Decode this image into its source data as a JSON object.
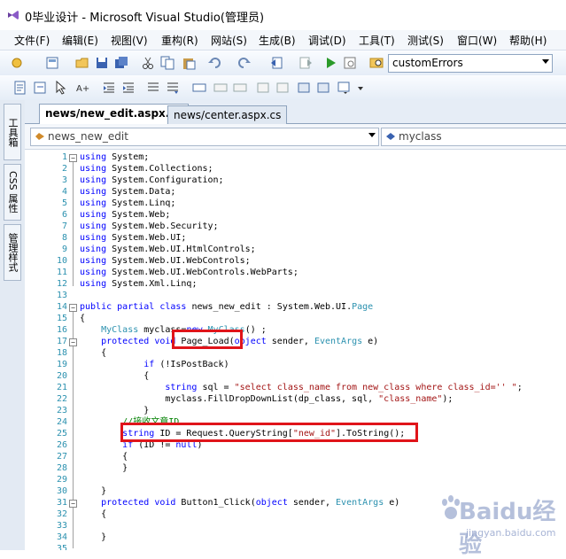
{
  "window": {
    "title": "0毕业设计 - Microsoft Visual Studio(管理员)"
  },
  "menu": [
    "文件(F)",
    "编辑(E)",
    "视图(V)",
    "重构(R)",
    "网站(S)",
    "生成(B)",
    "调试(D)",
    "工具(T)",
    "测试(S)",
    "窗口(W)",
    "帮助(H)"
  ],
  "toolbar": {
    "config_value": "customErrors"
  },
  "left_panel": {
    "toolbox_label": "工具箱",
    "css_label": "CSS 属性",
    "styles_label": "管理样式"
  },
  "tabs": [
    {
      "label": "news/new_edit.aspx.cs"
    },
    {
      "label": "news/center.aspx.cs"
    }
  ],
  "nav": {
    "class_combo": "news_new_edit",
    "member_combo": "myclass"
  },
  "code_lines": [
    {
      "n": "1",
      "t": "using System;"
    },
    {
      "n": "2",
      "t": "using System.Collections;"
    },
    {
      "n": "3",
      "t": "using System.Configuration;"
    },
    {
      "n": "4",
      "t": "using System.Data;"
    },
    {
      "n": "5",
      "t": "using System.Linq;"
    },
    {
      "n": "6",
      "t": "using System.Web;"
    },
    {
      "n": "7",
      "t": "using System.Web.Security;"
    },
    {
      "n": "8",
      "t": "using System.Web.UI;"
    },
    {
      "n": "9",
      "t": "using System.Web.UI.HtmlControls;"
    },
    {
      "n": "10",
      "t": "using System.Web.UI.WebControls;"
    },
    {
      "n": "11",
      "t": "using System.Web.UI.WebControls.WebParts;"
    },
    {
      "n": "12",
      "t": "using System.Xml.Linq;"
    },
    {
      "n": "13",
      "t": ""
    },
    {
      "n": "14",
      "t": "public partial class news_new_edit : System.Web.UI.Page"
    },
    {
      "n": "15",
      "t": "{"
    },
    {
      "n": "16",
      "t": "    MyClass myclass=new MyClass() ;"
    },
    {
      "n": "17",
      "t": "    protected void Page_Load(object sender, EventArgs e)"
    },
    {
      "n": "18",
      "t": "    {"
    },
    {
      "n": "19",
      "t": "            if (!IsPostBack)"
    },
    {
      "n": "20",
      "t": "            {"
    },
    {
      "n": "21",
      "t": "                string sql = \"select class_name from new_class where class_id='' \";"
    },
    {
      "n": "22",
      "t": "                myclass.FillDropDownList(dp_class, sql, \"class_name\");"
    },
    {
      "n": "23",
      "t": "            }"
    },
    {
      "n": "24",
      "t": "        //接收文章ID"
    },
    {
      "n": "25",
      "t": "        string ID = Request.QueryString[\"new_id\"].ToString();"
    },
    {
      "n": "26",
      "t": "        if (ID != null)"
    },
    {
      "n": "27",
      "t": "        {"
    },
    {
      "n": "28",
      "t": "        }"
    },
    {
      "n": "29",
      "t": ""
    },
    {
      "n": "30",
      "t": "    }"
    },
    {
      "n": "31",
      "t": "    protected void Button1_Click(object sender, EventArgs e)"
    },
    {
      "n": "32",
      "t": "    {"
    },
    {
      "n": "33",
      "t": ""
    },
    {
      "n": "34",
      "t": "    }"
    },
    {
      "n": "35",
      "t": ""
    }
  ],
  "watermark": {
    "logo": "Baidu经验",
    "site": "jingyan.baidu.com"
  },
  "colors": {
    "keyword": "#0000ff",
    "type": "#2b91af",
    "string": "#a31515",
    "comment": "#008000",
    "highlight": "#e0141a"
  }
}
